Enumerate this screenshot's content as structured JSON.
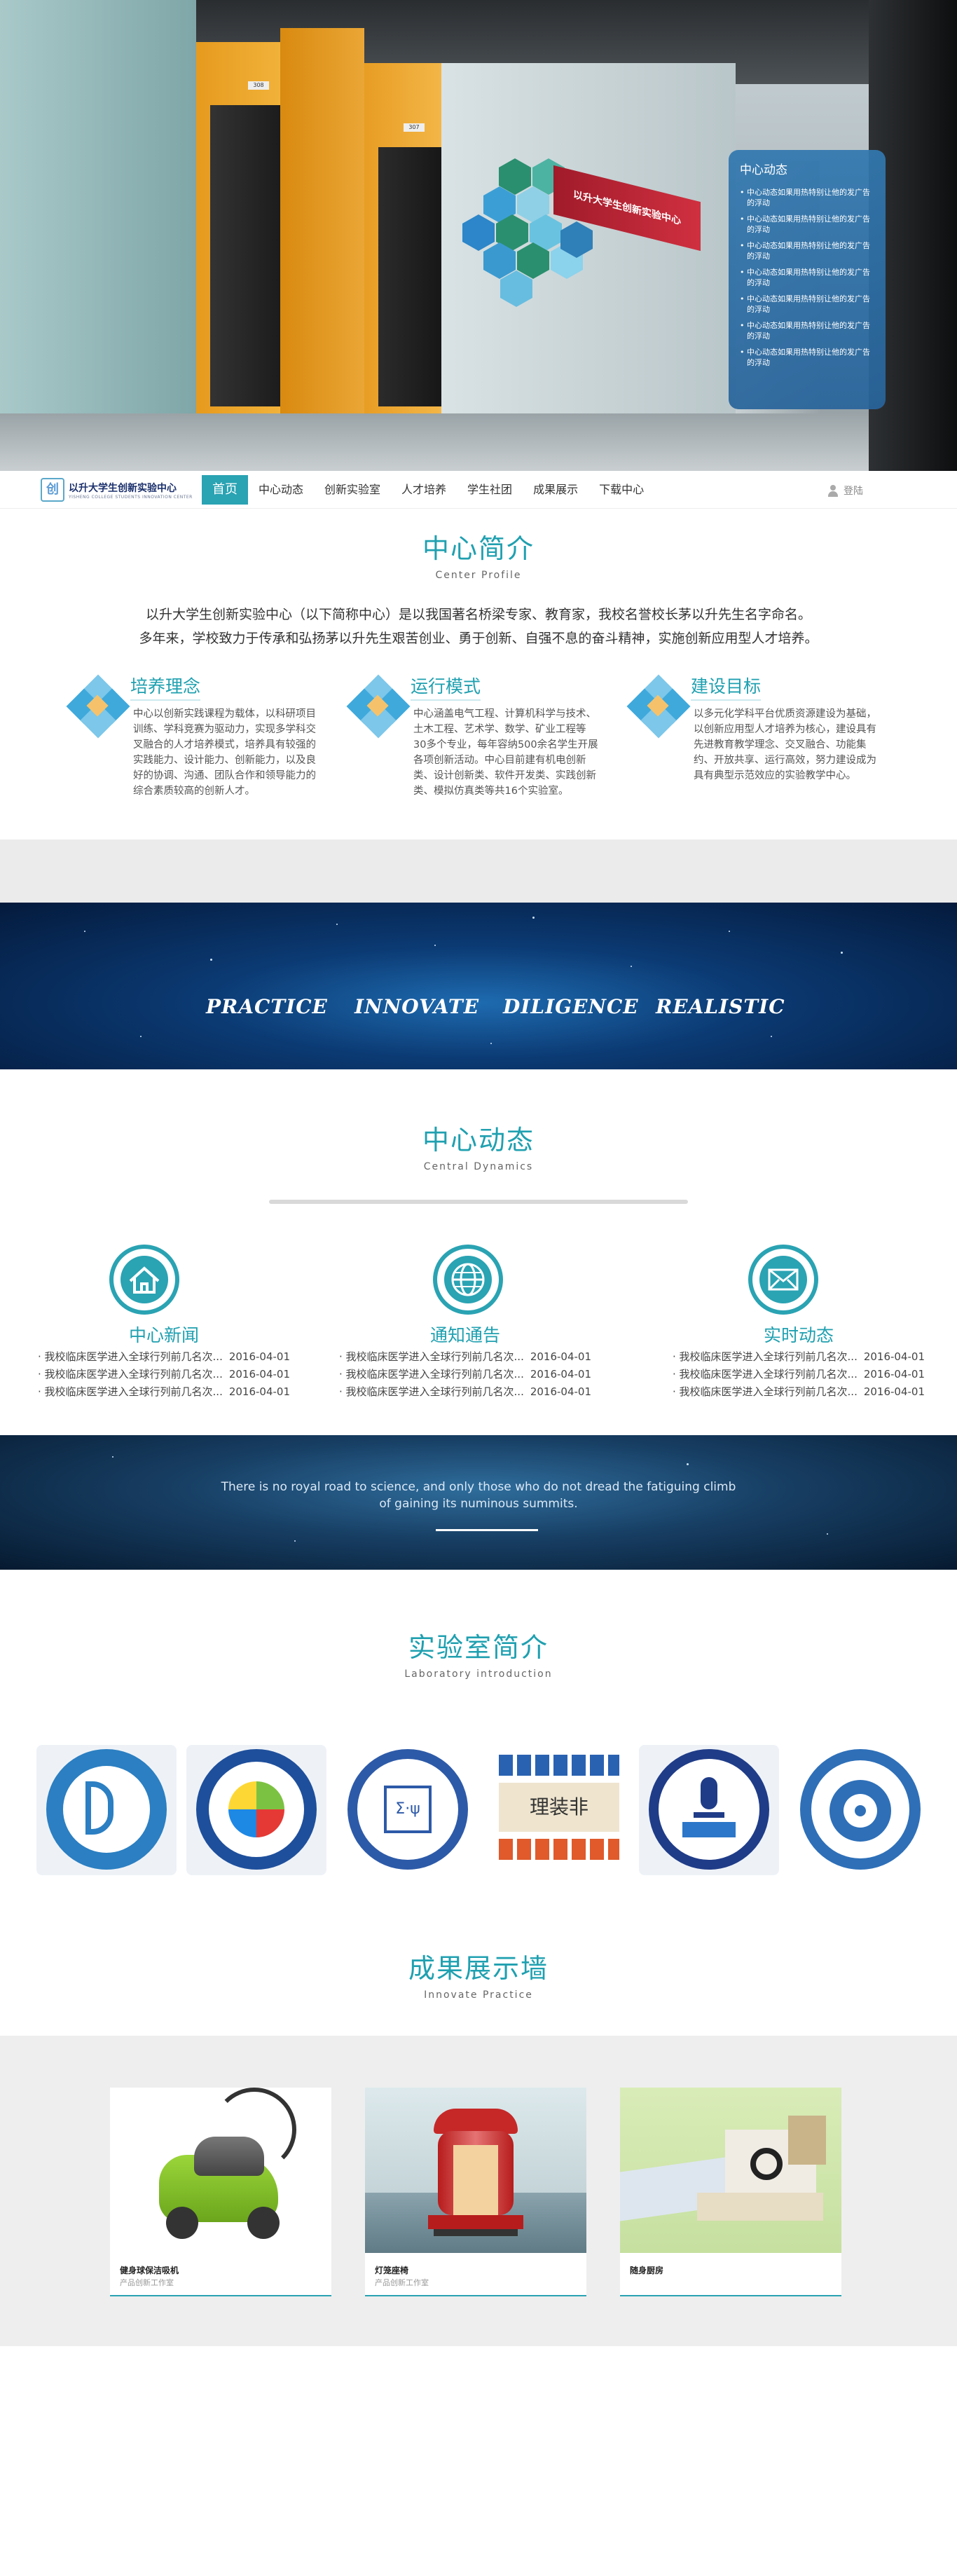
{
  "hero": {
    "panel_title": "中心动态",
    "panel_items": [
      "中心动态如果用热特别让他的发广告的浮动",
      "中心动态如果用热特别让他的发广告的浮动",
      "中心动态如果用热特别让他的发广告的浮动",
      "中心动态如果用热特别让他的发广告的浮动",
      "中心动态如果用热特别让他的发广告的浮动",
      "中心动态如果用热特别让他的发广告的浮动",
      "中心动态如果用热特别让他的发广告的浮动"
    ],
    "door_plate_1": "308",
    "door_plate_2": "307",
    "wall_sign": "以升大学生创新实验中心"
  },
  "nav": {
    "logo_mark": "创",
    "logo_cn": "以升大学生创新实验中心",
    "logo_en": "YISHENG COLLEGE STUDENTS INNOVATION CENTER",
    "items": [
      "首页",
      "中心动态",
      "创新实验室",
      "人才培养",
      "学生社团",
      "成果展示",
      "下载中心"
    ],
    "login": "登陆"
  },
  "intro": {
    "title_cn": "中心简介",
    "title_en": "Center Profile",
    "line1": "以升大学生创新实验中心（以下简称中心）是以我国著名桥梁专家、教育家，我校名誉校长茅以升先生名字命名。",
    "line2": "多年来，学校致力于传承和弘扬茅以升先生艰苦创业、勇于创新、自强不息的奋斗精神，实施创新应用型人才培养。",
    "features": [
      {
        "title": "培养理念",
        "text": "中心以创新实践课程为载体，以科研项目训练、学科竞赛为驱动力，实现多学科交叉融合的人才培养模式，培养具有较强的实践能力、设计能力、创新能力，以及良好的协调、沟通、团队合作和领导能力的综合素质较高的创新人才。"
      },
      {
        "title": "运行模式",
        "text": "中心涵盖电气工程、计算机科学与技术、土木工程、艺术学、数学、矿业工程等30多个专业，每年容纳500余名学生开展各项创新活动。中心目前建有机电创新类、设计创新类、软件开发类、实践创新类、模拟仿真类等共16个实验室。"
      },
      {
        "title": "建设目标",
        "text": "以多元化学科平台优质资源建设为基础，以创新应用型人才培养为核心，建设具有先进教育教学理念、交叉融合、功能集约、开放共享、运行高效，努力建设成为具有典型示范效应的实验教学中心。"
      }
    ]
  },
  "space": {
    "words": [
      "PRACTICE",
      "INNOVATE",
      "DILIGENCE",
      "REALISTIC"
    ]
  },
  "dynamics": {
    "title_cn": "中心动态",
    "title_en": "Central Dynamics",
    "columns": [
      {
        "title": "中心新闻",
        "icon": "house-icon",
        "items": [
          {
            "text": "· 我校临床医学进入全球行列前几名次...",
            "date": "2016-04-01"
          },
          {
            "text": "· 我校临床医学进入全球行列前几名次...",
            "date": "2016-04-01"
          },
          {
            "text": "· 我校临床医学进入全球行列前几名次...",
            "date": "2016-04-01"
          }
        ]
      },
      {
        "title": "通知通告",
        "icon": "globe-icon",
        "items": [
          {
            "text": "· 我校临床医学进入全球行列前几名次...",
            "date": "2016-04-01"
          },
          {
            "text": "· 我校临床医学进入全球行列前几名次...",
            "date": "2016-04-01"
          },
          {
            "text": "· 我校临床医学进入全球行列前几名次...",
            "date": "2016-04-01"
          }
        ]
      },
      {
        "title": "实时动态",
        "icon": "envelope-icon",
        "items": [
          {
            "text": "· 我校临床医学进入全球行列前几名次...",
            "date": "2016-04-01"
          },
          {
            "text": "· 我校临床医学进入全球行列前几名次...",
            "date": "2016-04-01"
          },
          {
            "text": "· 我校临床医学进入全球行列前几名次...",
            "date": "2016-04-01"
          }
        ]
      }
    ]
  },
  "quote": {
    "text": "There is no royal road to science, and only those who do not dread the fatiguing climb of gaining its numinous summits."
  },
  "labs": {
    "title_cn": "实验室简介",
    "title_en": "Laboratory introduction",
    "logos": [
      "lab-logo-innovation-design",
      "lab-logo-calligraphy",
      "lab-logo-math-modeling",
      "lab-logo-reading",
      "lab-logo-microphone",
      "lab-logo-wifi"
    ],
    "calligraphy_text": "理装非"
  },
  "works": {
    "title_cn": "成果展示墙",
    "title_en": "Innovate  Practice",
    "cards": [
      {
        "name": "健身球保洁吸机",
        "studio": "产品创新工作室"
      },
      {
        "name": "灯笼座椅",
        "studio": "产品创新工作室"
      },
      {
        "name": "随身厨房",
        "studio": ""
      }
    ]
  },
  "colors": {
    "accent": "#2aa3b3",
    "panel": "#3278af"
  }
}
